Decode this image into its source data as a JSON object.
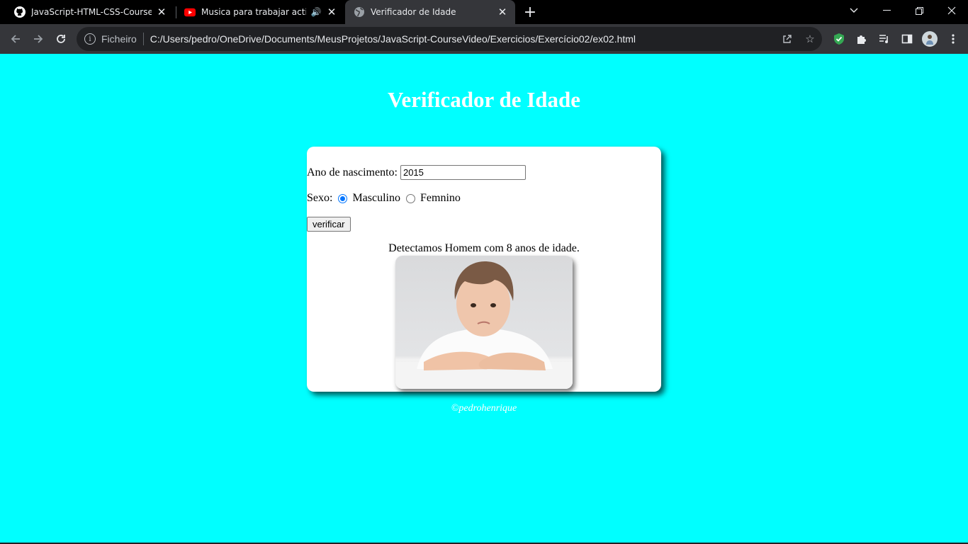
{
  "browser": {
    "tabs": [
      {
        "title": "JavaScript-HTML-CSS-CourseVid",
        "favicon": "github-icon"
      },
      {
        "title": "Musica para trabajar activo y",
        "favicon": "youtube-icon",
        "audio": "speaker-icon"
      },
      {
        "title": "Verificador de Idade",
        "favicon": "globe-icon",
        "active": true
      }
    ],
    "address": {
      "scheme": "Ficheiro",
      "url": "C:/Users/pedro/OneDrive/Documents/MeusProjetos/JavaScript-CourseVideo/Exercicios/Exercício02/ex02.html"
    }
  },
  "page": {
    "title": "Verificador de Idade",
    "form": {
      "year_label": "Ano de nascimento:",
      "year_value": "2015",
      "sex_label": "Sexo:",
      "options": [
        "Masculino",
        "Femnino"
      ],
      "selected": "Masculino",
      "button_label": "verificar"
    },
    "result": "Detectamos Homem com 8 anos de idade.",
    "footer": "©pedrohenrique"
  },
  "colors": {
    "page_background": "#00ffff",
    "card_background": "#ffffff",
    "title_color": "#ffffff",
    "radio_accent": "#0075ff"
  }
}
